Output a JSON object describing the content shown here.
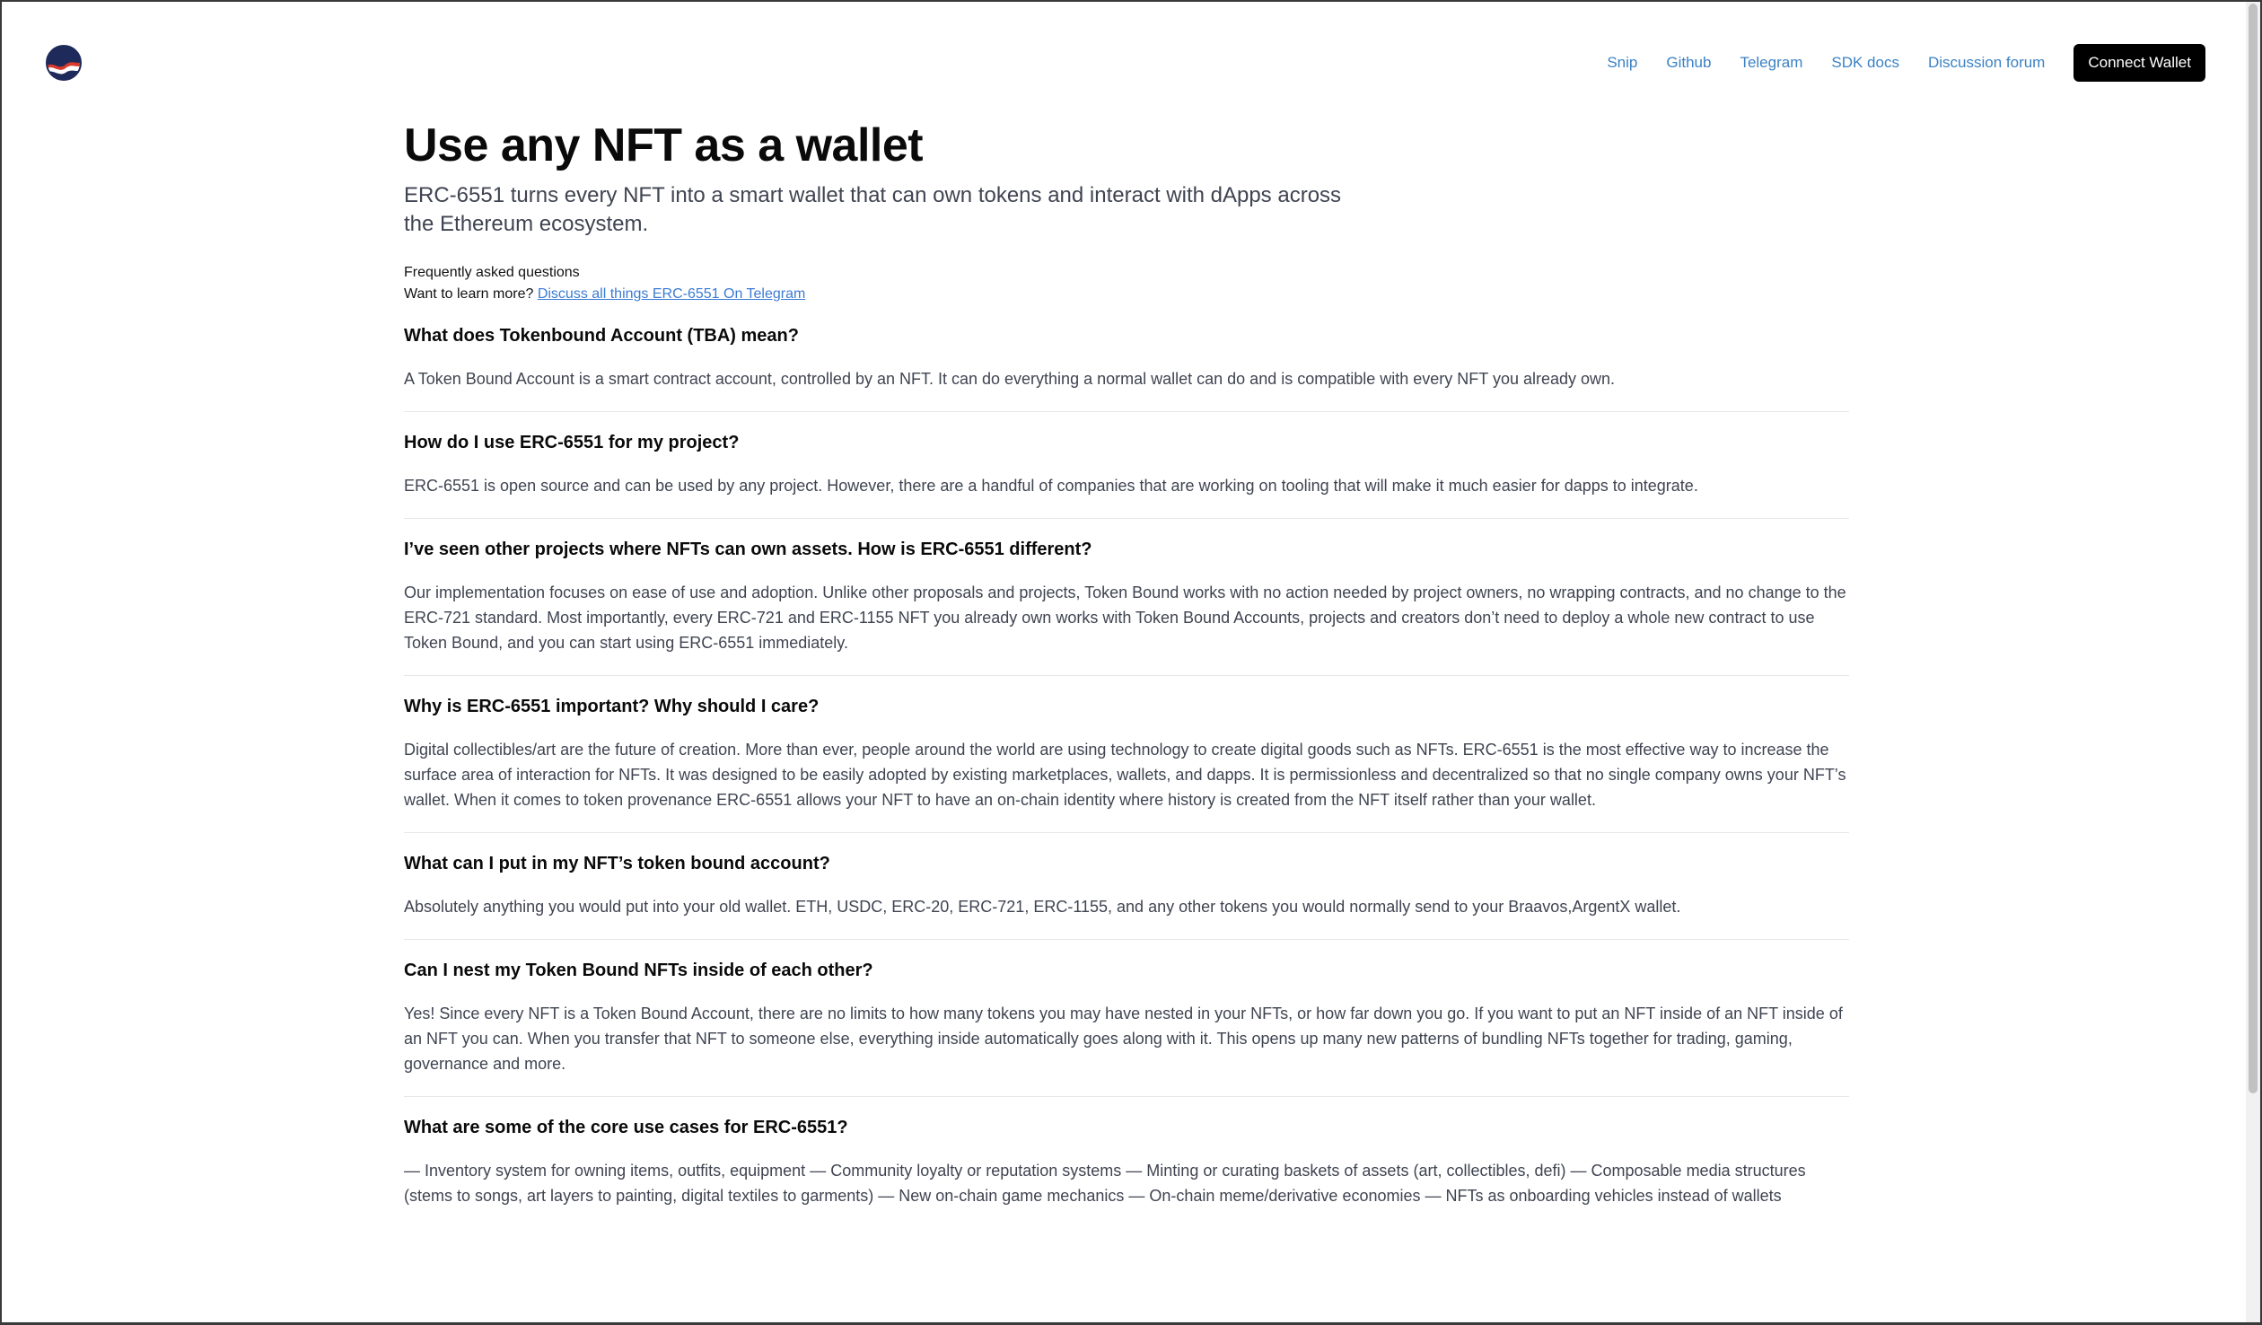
{
  "header": {
    "nav": [
      "Snip",
      "Github",
      "Telegram",
      "SDK docs",
      "Discussion forum"
    ],
    "connect_label": "Connect Wallet"
  },
  "hero": {
    "title": "Use any NFT as a wallet",
    "subtitle": "ERC-6551 turns every NFT into a smart wallet that can own tokens and interact with dApps across the Ethereum ecosystem."
  },
  "faq": {
    "label": "Frequently asked questions",
    "learn_prefix": "Want to learn more? ",
    "learn_link": "Discuss all things ERC-6551 On Telegram",
    "items": [
      {
        "q": "What does Tokenbound Account (TBA) mean?",
        "a": "A Token Bound Account is a smart contract account, controlled by an NFT. It can do everything a normal wallet can do and is compatible with every NFT you already own."
      },
      {
        "q": "How do I use ERC-6551 for my project?",
        "a": "ERC-6551 is open source and can be used by any project. However, there are a handful of companies that are working on tooling that will make it much easier for dapps to integrate."
      },
      {
        "q": "I’ve seen other projects where NFTs can own assets. How is ERC-6551 different?",
        "a": "Our implementation focuses on ease of use and adoption. Unlike other proposals and projects, Token Bound works with no action needed by project owners, no wrapping contracts, and no change to the ERC-721 standard. Most importantly, every ERC-721 and ERC-1155 NFT you already own works with Token Bound Accounts, projects and creators don’t need to deploy a whole new contract to use Token Bound, and you can start using ERC-6551 immediately."
      },
      {
        "q": "Why is ERC-6551 important? Why should I care?",
        "a": "Digital collectibles/art are the future of creation. More than ever, people around the world are using technology to create digital goods such as NFTs. ERC-6551 is the most effective way to increase the surface area of interaction for NFTs. It was designed to be easily adopted by existing marketplaces, wallets, and dapps. It is permissionless and decentralized so that no single company owns your NFT’s wallet. When it comes to token provenance ERC-6551 allows your NFT to have an on-chain identity where history is created from the NFT itself rather than your wallet."
      },
      {
        "q": "What can I put in my NFT’s token bound account?",
        "a": "Absolutely anything you would put into your old wallet. ETH, USDC, ERC-20, ERC-721, ERC-1155, and any other tokens you would normally send to your Braavos,ArgentX wallet."
      },
      {
        "q": "Can I nest my Token Bound NFTs inside of each other?",
        "a": "Yes! Since every NFT is a Token Bound Account, there are no limits to how many tokens you may have nested in your NFTs, or how far down you go. If you want to put an NFT inside of an NFT inside of an NFT you can. When you transfer that NFT to someone else, everything inside automatically goes along with it. This opens up many new patterns of bundling NFTs together for trading, gaming, governance and more."
      },
      {
        "q": "What are some of the core use cases for ERC-6551?",
        "a": "— Inventory system for owning items, outfits, equipment — Community loyalty or reputation systems — Minting or curating baskets of assets (art, collectibles, defi) — Composable media structures (stems to songs, art layers to painting, digital textiles to garments) — New on-chain game mechanics — On-chain meme/derivative economies — NFTs as onboarding vehicles instead of wallets"
      }
    ]
  }
}
